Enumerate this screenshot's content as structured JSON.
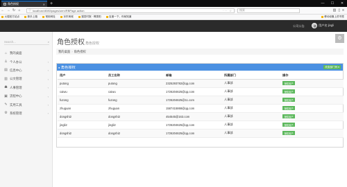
{
  "browser": {
    "tab_title": "角色授权",
    "url": "localhost:8080/pages/oem/RBPage.action",
    "search_placeholder": "搜索",
    "bookmarks": [
      "火狐官方站点",
      "新手上路",
      "常用网址",
      "京东商城",
      "猫发时报 · 傅泉阳",
      "百度一下，你就知道"
    ],
    "mobile_bookmarks": "移动设备上的书签"
  },
  "header": {
    "link_announce": "公司公告",
    "user_label": "用户名:jingli"
  },
  "sidebar": {
    "search_placeholder": "Search...",
    "items": [
      {
        "label": "我的桌面",
        "icon": "home-icon",
        "glyph": "⌂",
        "has_chevron": false
      },
      {
        "label": "个人办公",
        "icon": "user-icon",
        "glyph": "♙",
        "has_chevron": true
      },
      {
        "label": "信息中心",
        "icon": "info-icon",
        "glyph": "▤",
        "has_chevron": true
      },
      {
        "label": "公文管理",
        "icon": "document-icon",
        "glyph": "▥",
        "has_chevron": true
      },
      {
        "label": "人事管理",
        "icon": "users-icon",
        "glyph": "☗",
        "has_chevron": true
      },
      {
        "label": "流程中心",
        "icon": "flow-icon",
        "glyph": "▣",
        "has_chevron": true
      },
      {
        "label": "实用工具",
        "icon": "tools-icon",
        "glyph": "✎",
        "has_chevron": true
      },
      {
        "label": "系统管理",
        "icon": "settings-icon",
        "glyph": "⚙",
        "has_chevron": true
      }
    ]
  },
  "page": {
    "title": "角色授权",
    "subtitle": "角色授权",
    "breadcrumb": [
      "我的桌面",
      "角色授权"
    ]
  },
  "panel": {
    "title": "角色授权",
    "select_label": "改变部门列 ▾",
    "columns": [
      "用户",
      "员工名称",
      "邮箱",
      "所属部门",
      "操作"
    ],
    "rows": [
      {
        "user": "putong",
        "name": "putong",
        "email": "2325293782@qq.com",
        "dept": "人事部",
        "action": "授权用户"
      },
      {
        "user": "caiwu",
        "name": "caiwu",
        "email": "1726204625@qq.com",
        "dept": "人事部",
        "action": "授权用户"
      },
      {
        "user": "fuzong",
        "name": "fuzong",
        "email": "1726204625@11.com",
        "dept": "人事部",
        "action": "授权用户"
      },
      {
        "user": "zhuguan",
        "name": "zhuguan",
        "email": "1587415868@qq.com",
        "dept": "人事部",
        "action": "授权用户"
      },
      {
        "user": "dongshi2",
        "name": "dongshi2",
        "email": "454545@163.com",
        "dept": "人事部",
        "action": "授权用户"
      },
      {
        "user": "jingli2",
        "name": "jingli2",
        "email": "1726204625@qq.com",
        "dept": "人事部",
        "action": "授权用户"
      },
      {
        "user": "dongshi2",
        "name": "dongshi2",
        "email": "1726204625@qq.com",
        "dept": "人事部",
        "action": "授权用户"
      }
    ]
  }
}
